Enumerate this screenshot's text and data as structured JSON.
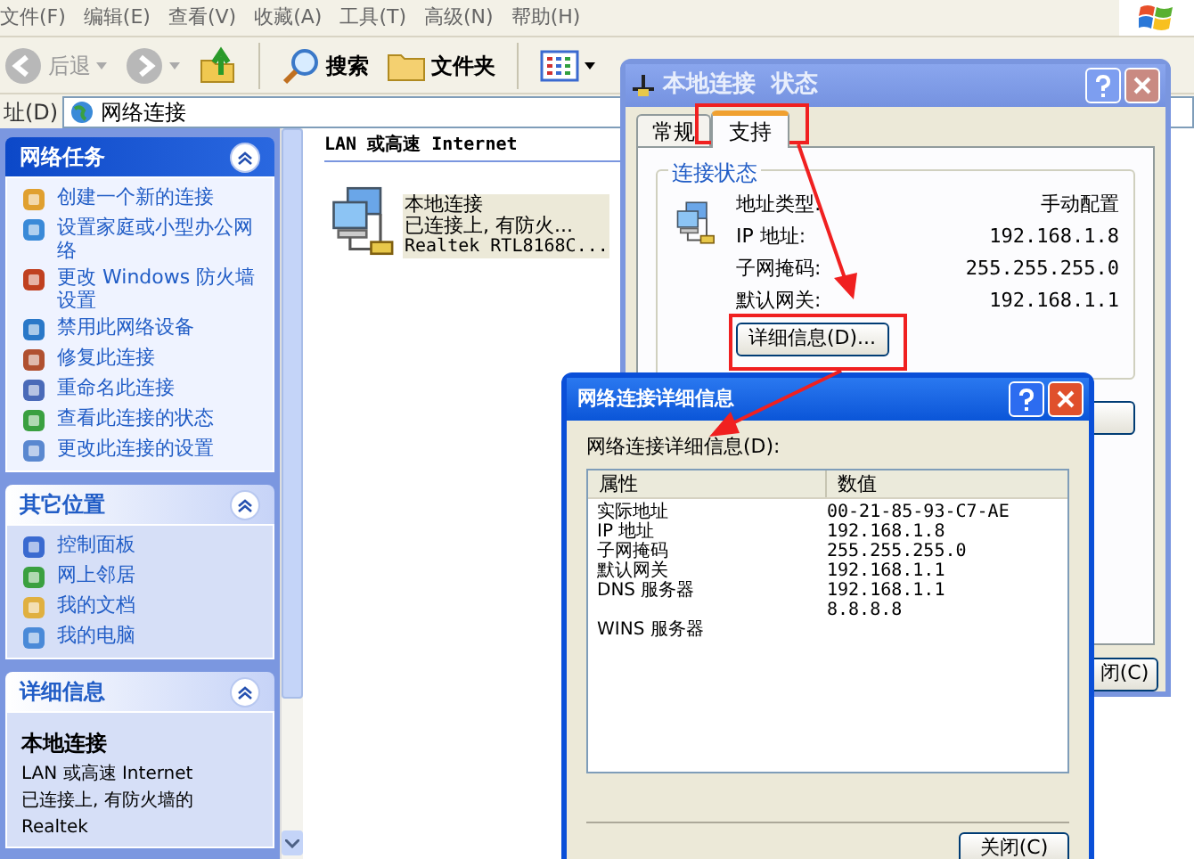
{
  "menu": [
    "文件(F)",
    "编辑(E)",
    "查看(V)",
    "收藏(A)",
    "工具(T)",
    "高级(N)",
    "帮助(H)"
  ],
  "toolbar": [
    {
      "kind": "back",
      "label": "后退",
      "disabled": true
    },
    {
      "kind": "forward",
      "disabled": true
    },
    {
      "kind": "up",
      "disabled": false
    },
    {
      "kind": "search",
      "label": "搜索",
      "disabled": false
    },
    {
      "kind": "folders",
      "label": "文件夹",
      "disabled": false
    },
    {
      "kind": "views",
      "disabled": false
    }
  ],
  "address": {
    "label": "址(D)",
    "value": "网络连接"
  },
  "sidebar": [
    {
      "title": "网络任务",
      "primary": true,
      "expanded": true,
      "items": [
        "创建一个新的连接",
        "设置家庭或小型办公网络",
        "更改 Windows 防火墙设置",
        "禁用此网络设备",
        "修复此连接",
        "重命名此连接",
        "查看此连接的状态",
        "更改此连接的设置"
      ]
    },
    {
      "title": "其它位置",
      "primary": false,
      "expanded": true,
      "items": [
        "控制面板",
        "网上邻居",
        "我的文档",
        "我的电脑"
      ]
    },
    {
      "title": "详细信息",
      "primary": false,
      "expanded": true,
      "heading": "本地连接",
      "lines": [
        "LAN 或高速 Internet",
        "已连接上, 有防火墙的",
        "Realtek"
      ]
    }
  ],
  "content": {
    "group_header": "LAN 或高速 Internet",
    "connection": {
      "name": "本地连接",
      "status": "已连接上, 有防火...",
      "device": "Realtek RTL8168C...",
      "selected": true
    }
  },
  "status_dialog": {
    "title": "本地连接  状态",
    "tabs": [
      {
        "label": "常规",
        "selected": false
      },
      {
        "label": "支持",
        "selected": true
      }
    ],
    "group": "连接状态",
    "rows": [
      {
        "label": "地址类型:",
        "value": "手动配置"
      },
      {
        "label": "IP 地址:",
        "value": "192.168.1.8"
      },
      {
        "label": "子网掩码:",
        "value": "255.255.255.0"
      },
      {
        "label": "默认网关:",
        "value": "192.168.1.1"
      }
    ],
    "details_button": "详细信息(D)...",
    "close_button": "闭(C)"
  },
  "details_dialog": {
    "title": "网络连接详细信息",
    "list_label": "网络连接详细信息(D):",
    "columns": [
      "属性",
      "数值"
    ],
    "rows": [
      {
        "property": "实际地址",
        "values": [
          "00-21-85-93-C7-AE"
        ]
      },
      {
        "property": "IP 地址",
        "values": [
          "192.168.1.8"
        ]
      },
      {
        "property": "子网掩码",
        "values": [
          "255.255.255.0"
        ]
      },
      {
        "property": "默认网关",
        "values": [
          "192.168.1.1"
        ]
      },
      {
        "property": "DNS 服务器",
        "values": [
          "192.168.1.1",
          "8.8.8.8"
        ]
      },
      {
        "property": "WINS 服务器"
      }
    ],
    "close_button": "关闭(C)"
  }
}
